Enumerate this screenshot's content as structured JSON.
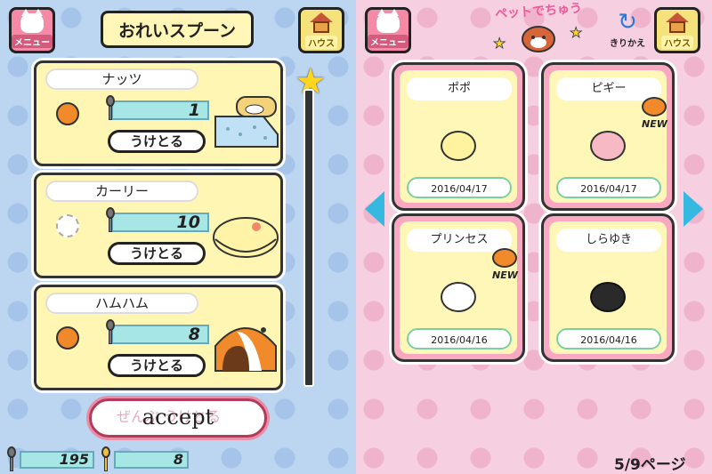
{
  "left_panel": {
    "menu_label": "メニュー",
    "house_label": "ハウス",
    "title": "おれいスプーン",
    "rewards": [
      {
        "name": "ナッツ",
        "count": "1",
        "button": "うけとる",
        "item": "bed"
      },
      {
        "name": "カーリー",
        "count": "10",
        "button": "うけとる",
        "item": "cushion"
      },
      {
        "name": "ハムハム",
        "count": "8",
        "button": "うけとる",
        "item": "dome"
      }
    ],
    "accept_label": "accept",
    "accept_ghost": "ぜんぶ うけとる",
    "spoon_total": "195",
    "gold_spoon_total": "8"
  },
  "right_panel": {
    "menu_label": "メニュー",
    "logo_label": "ペットでちゅう",
    "switch_label": "きりかえ",
    "house_label": "ハウス",
    "pets": [
      {
        "name": "ポポ",
        "date": "2016/04/17",
        "new": false,
        "color": "#fff3a0"
      },
      {
        "name": "ピギー",
        "date": "2016/04/17",
        "new": true,
        "new_label": "NEW",
        "color": "#f7b9c4"
      },
      {
        "name": "プリンセス",
        "date": "2016/04/16",
        "new": true,
        "new_label": "NEW",
        "color": "#ffffff"
      },
      {
        "name": "しらゆき",
        "date": "2016/04/16",
        "new": false,
        "color": "#2a2a2a"
      }
    ],
    "page": "5/9ページ"
  },
  "colors": {
    "left_bg": "#bcd6f2",
    "right_bg": "#f6cfe0",
    "card_bg": "#fff6b3",
    "meter": "#a6e6e4"
  }
}
